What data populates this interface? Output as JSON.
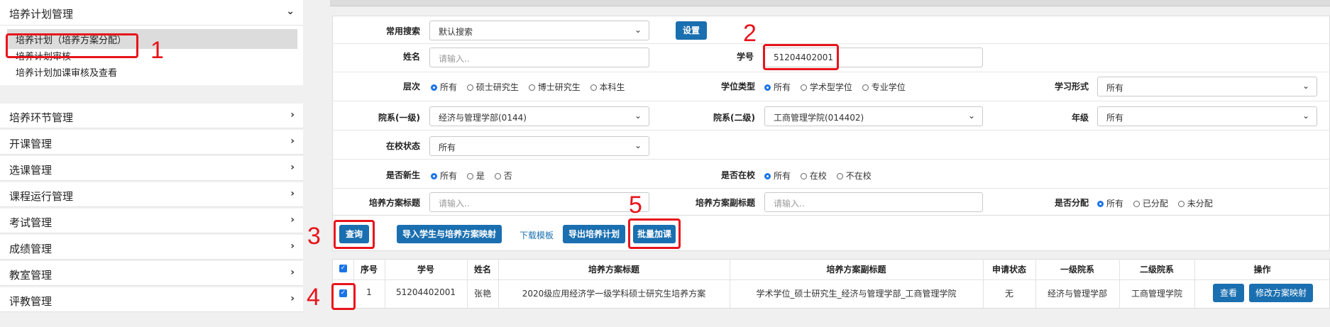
{
  "sidebar": {
    "expanded_menu": "培养计划管理",
    "sub_items": [
      "培养计划（培养方案分配）",
      "培养计划审核",
      "培养计划加课审核及查看"
    ],
    "menus": [
      "培养环节管理",
      "开课管理",
      "选课管理",
      "课程运行管理",
      "考试管理",
      "成绩管理",
      "教室管理",
      "评教管理"
    ]
  },
  "annotations": [
    "1",
    "2",
    "3",
    "4",
    "5"
  ],
  "form": {
    "common_search_label": "常用搜索",
    "common_search_value": "默认搜索",
    "settings_button": "设置",
    "name_label": "姓名",
    "name_placeholder": "请输入..",
    "student_id_label": "学号",
    "student_id_value": "51204402001",
    "level_label": "层次",
    "level_options": [
      "所有",
      "硕士研究生",
      "博士研究生",
      "本科生"
    ],
    "degree_type_label": "学位类型",
    "degree_type_options": [
      "所有",
      "学术型学位",
      "专业学位"
    ],
    "study_form_label": "学习形式",
    "study_form_value": "所有",
    "dept1_label": "院系(一级)",
    "dept1_value": "经济与管理学部(0144)",
    "dept2_label": "院系(二级)",
    "dept2_value": "工商管理学院(014402)",
    "grade_label": "年级",
    "grade_value": "所有",
    "status_label": "在校状态",
    "status_value": "所有",
    "new_student_label": "是否新生",
    "new_student_options": [
      "所有",
      "是",
      "否"
    ],
    "in_school_label": "是否在校",
    "in_school_options": [
      "所有",
      "在校",
      "不在校"
    ],
    "plan_title_label": "培养方案标题",
    "plan_title_placeholder": "请输入..",
    "plan_subtitle_label": "培养方案副标题",
    "plan_subtitle_placeholder": "请输入..",
    "assigned_label": "是否分配",
    "assigned_options": [
      "所有",
      "已分配",
      "未分配"
    ]
  },
  "actions": {
    "query": "查询",
    "import_mapping": "导入学生与培养方案映射",
    "download_template": "下载模板",
    "export_plan": "导出培养计划",
    "batch_add": "批量加课"
  },
  "table": {
    "headers": [
      "序号",
      "学号",
      "姓名",
      "培养方案标题",
      "培养方案副标题",
      "申请状态",
      "一级院系",
      "二级院系",
      "操作"
    ],
    "rows": [
      {
        "index": "1",
        "student_id": "51204402001",
        "name": "张艳",
        "plan_title": "2020级应用经济学一级学科硕士研究生培养方案",
        "plan_subtitle": "学术学位_硕士研究生_经济与管理学部_工商管理学院",
        "apply_status": "无",
        "dept1": "经济与管理学部",
        "dept2": "工商管理学院",
        "view": "查看",
        "modify": "修改方案映射"
      }
    ]
  },
  "colors": {
    "accent": "#1a6fb0",
    "annotation": "#e8141c",
    "radio_selected": "#1a73e8"
  }
}
